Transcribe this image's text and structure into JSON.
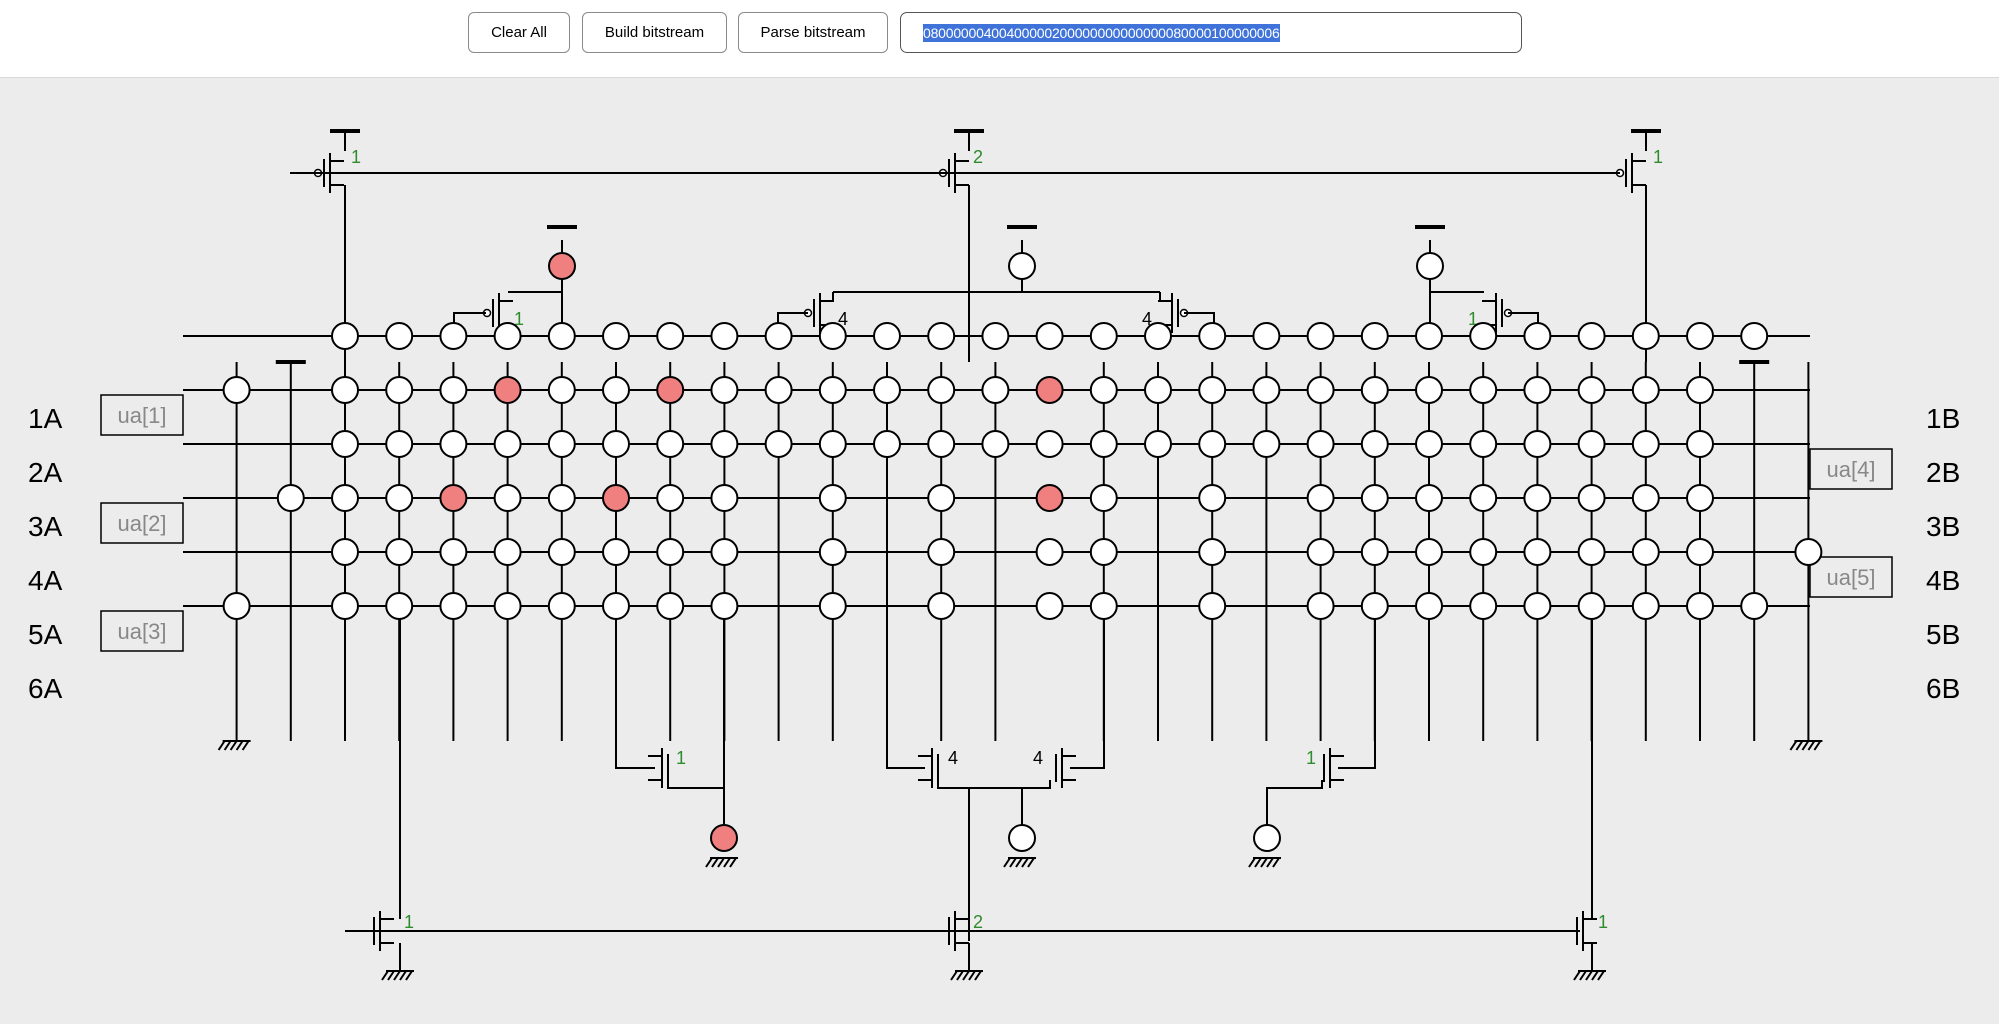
{
  "toolbar": {
    "clear_label": "Clear All",
    "build_label": "Build bitstream",
    "parse_label": "Parse bitstream",
    "bitstream_value": "08000000400400000200000000000000080000100000006"
  },
  "colors": {
    "active_switch": "#f08080",
    "inactive_switch": "#ffffff",
    "wire": "#000000",
    "transistor_number_green": "#2e8b2e",
    "transistor_number_black": "#000000",
    "canvas_bg": "#ececec"
  },
  "rows": {
    "left_labels": [
      "1A",
      "2A",
      "3A",
      "4A",
      "5A",
      "6A"
    ],
    "right_labels": [
      "1B",
      "2B",
      "3B",
      "4B",
      "5B",
      "6B"
    ]
  },
  "ua_pins": [
    {
      "label": "ua[1]",
      "side": "left",
      "row": 1
    },
    {
      "label": "ua[2]",
      "side": "left",
      "row": 3
    },
    {
      "label": "ua[3]",
      "side": "left",
      "row": 5
    },
    {
      "label": "ua[4]",
      "side": "right",
      "row": 2
    },
    {
      "label": "ua[5]",
      "side": "right",
      "row": 4
    }
  ],
  "transistors": {
    "top_pmos": [
      "1",
      "2",
      "1"
    ],
    "upper_pmos": [
      "1",
      "4",
      "4",
      "1"
    ],
    "lower_nmos": [
      "1",
      "4",
      "4",
      "1"
    ],
    "bottom_nmos": [
      "1",
      "2",
      "1"
    ]
  },
  "switches": {
    "row1": {
      "cols": [
        0,
        1,
        2,
        3,
        4,
        5,
        6,
        7,
        8,
        9,
        10,
        11,
        12,
        14,
        15,
        16,
        17,
        18,
        19,
        20,
        21,
        22,
        23,
        24,
        25,
        26
      ],
      "active": []
    },
    "row2": {
      "cols": [
        -2,
        0,
        1,
        2,
        3,
        4,
        5,
        6,
        7,
        8,
        9,
        10,
        11,
        12,
        14,
        15,
        16,
        17,
        18,
        19,
        20,
        21,
        22,
        23,
        24,
        25
      ],
      "active": [
        3,
        6
      ]
    },
    "row3": {
      "cols": [
        0,
        1,
        2,
        3,
        4,
        5,
        6,
        7,
        8,
        9,
        10,
        11,
        12,
        14,
        15,
        16,
        17,
        18,
        19,
        20,
        21,
        22,
        23,
        24,
        25
      ],
      "active": []
    },
    "row4": {
      "cols": [
        -1,
        0,
        1,
        2,
        3,
        4,
        5,
        6,
        7,
        9,
        11,
        14,
        16,
        18,
        19,
        20,
        21,
        22,
        23,
        24,
        25
      ],
      "active": [
        2,
        5
      ]
    },
    "row5": {
      "cols": [
        0,
        1,
        2,
        3,
        4,
        5,
        6,
        7,
        9,
        11,
        14,
        16,
        18,
        19,
        20,
        21,
        22,
        23,
        24,
        25,
        27
      ],
      "active": []
    },
    "row6": {
      "cols": [
        -2,
        0,
        1,
        2,
        3,
        4,
        5,
        6,
        7,
        9,
        11,
        14,
        16,
        18,
        19,
        20,
        21,
        22,
        23,
        24,
        25,
        26
      ],
      "active": []
    }
  },
  "nodes": {
    "center_column": [
      "off",
      "on",
      "off",
      "on",
      "off",
      "off"
    ],
    "top": [
      "on",
      "off",
      "off"
    ],
    "bottom": [
      "on",
      "off",
      "off"
    ]
  }
}
